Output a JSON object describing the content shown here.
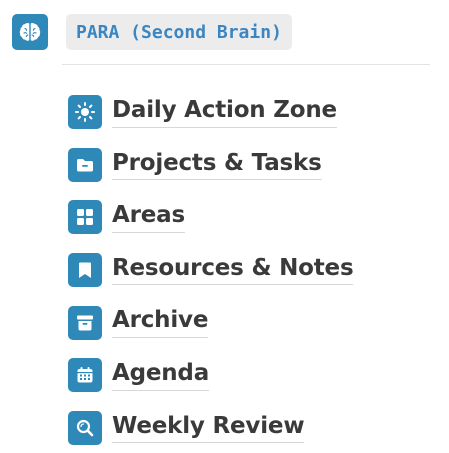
{
  "header": {
    "icon": "brain-icon",
    "title": "PARA (Second Brain)"
  },
  "colors": {
    "accent": "#2e88b8",
    "title_text": "#3b86c2",
    "title_bg": "#ececec",
    "item_text": "#3a3a3a"
  },
  "nav": {
    "items": [
      {
        "label": "Daily Action Zone",
        "icon": "sun-icon"
      },
      {
        "label": "Projects & Tasks",
        "icon": "folder-icon"
      },
      {
        "label": "Areas",
        "icon": "grid-icon"
      },
      {
        "label": "Resources & Notes",
        "icon": "bookmark-icon"
      },
      {
        "label": "Archive",
        "icon": "archive-box-icon"
      },
      {
        "label": "Agenda",
        "icon": "calendar-icon"
      },
      {
        "label": "Weekly Review",
        "icon": "search-icon"
      }
    ]
  }
}
